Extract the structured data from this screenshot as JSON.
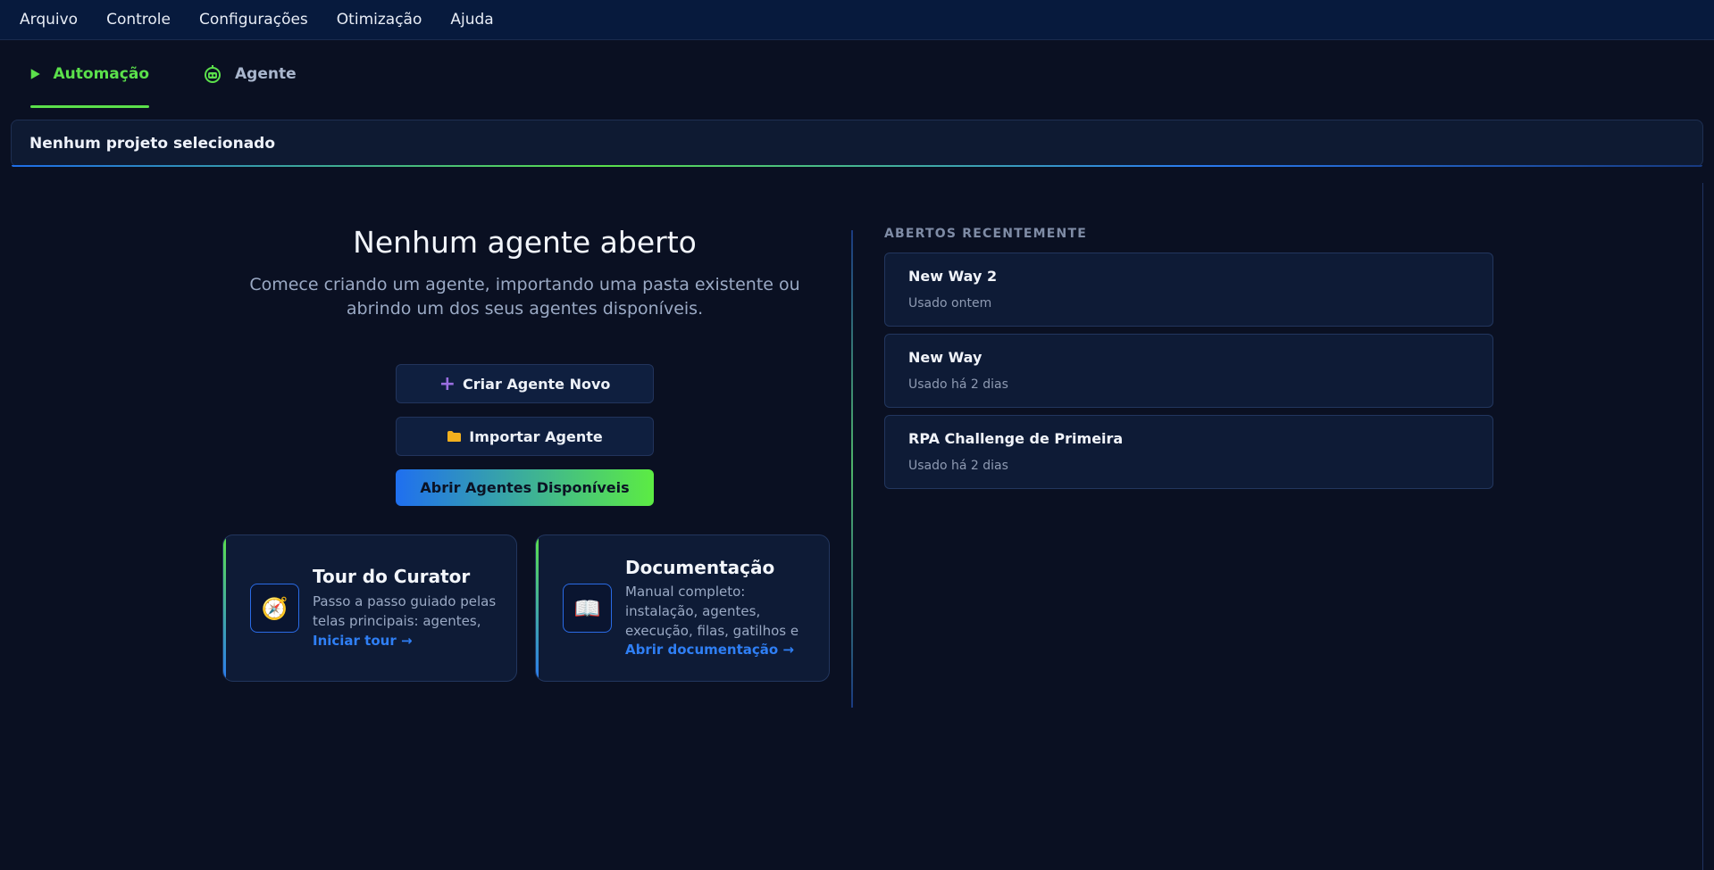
{
  "menubar": {
    "items": [
      "Arquivo",
      "Controle",
      "Configurações",
      "Otimização",
      "Ajuda"
    ]
  },
  "tabs": {
    "automacao": "Automação",
    "agente": "Agente"
  },
  "project": {
    "label": "Nenhum projeto selecionado"
  },
  "empty_state": {
    "title": "Nenhum agente aberto",
    "subtitle": "Comece criando um agente, importando uma pasta existente ou abrindo um dos seus agentes disponíveis.",
    "btn_criar": "Criar Agente Novo",
    "btn_importar": "Importar Agente",
    "btn_abrir": "Abrir Agentes Disponíveis"
  },
  "cards": {
    "tour": {
      "title": "Tour do Curator",
      "desc": "Passo a passo guiado pelas telas principais: agentes,",
      "link": "Iniciar tour →"
    },
    "doc": {
      "title": "Documentação",
      "desc": "Manual completo: instalação, agentes, execução, filas, gatilhos e",
      "link": "Abrir documentação →"
    }
  },
  "recent": {
    "title": "ABERTOS RECENTEMENTE",
    "items": [
      {
        "name": "New Way 2",
        "time": "Usado ontem"
      },
      {
        "name": "New Way",
        "time": "Usado há 2 dias"
      },
      {
        "name": "RPA Challenge de Primeira",
        "time": "Usado há 2 dias"
      }
    ]
  },
  "colors": {
    "accent_green": "#5be04b",
    "accent_blue": "#2f7ff5",
    "background": "#0a1022"
  }
}
